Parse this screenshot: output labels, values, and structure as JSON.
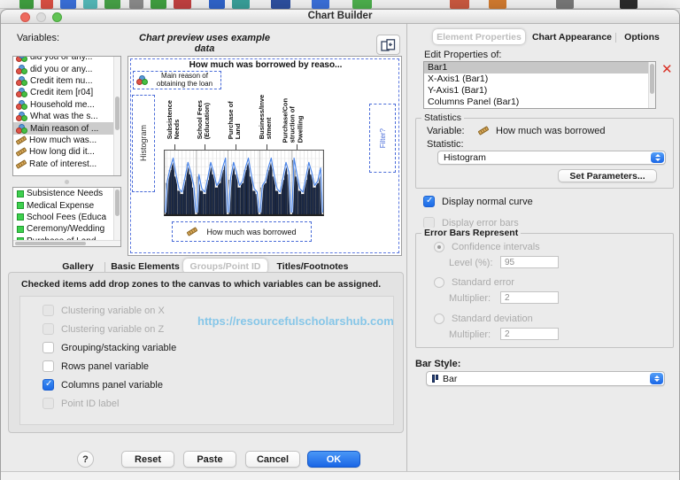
{
  "window": {
    "title": "Chart Builder"
  },
  "left": {
    "variables_label": "Variables:",
    "preview_caption": "Chart preview uses example data",
    "variables": [
      {
        "label": "did you or any..."
      },
      {
        "label": "did you or any..."
      },
      {
        "label": "Credit item nu..."
      },
      {
        "label": "Credit item [r04]"
      },
      {
        "label": "Household me..."
      },
      {
        "label": "What was the s..."
      },
      {
        "label": "Main reason of ..."
      },
      {
        "label": "How much was..."
      },
      {
        "label": "How long did it..."
      },
      {
        "label": "Rate of interest..."
      }
    ],
    "categories": [
      "Subsistence Needs",
      "Medical Expense",
      "School Fees (Educa",
      "Ceremony/Wedding",
      "Purchase of Land"
    ]
  },
  "preview": {
    "title": "How much was borrowed by reaso...",
    "row_drop_zone": "Main reason of obtaining the loan",
    "y_axis_zone": "Histogram",
    "x_axis_zone": "How much was borrowed",
    "filter_zone": "Filter?",
    "panel_labels": [
      "Subsistence\nNeeds",
      "School Fees\n(Education)",
      "Purchase of\nLand",
      "Business/Inve\nstment",
      "Purchase/Con\nstruction of\nDwelling"
    ]
  },
  "bottom_tabs": {
    "gallery": "Gallery",
    "basic_elements": "Basic Elements",
    "groups_point_id": "Groups/Point ID",
    "titles_footnotes": "Titles/Footnotes"
  },
  "groups_panel": {
    "description": "Checked items add drop zones to the canvas to which variables can be assigned.",
    "options": [
      {
        "label": "Clustering variable on X",
        "checked": false,
        "enabled": false
      },
      {
        "label": "Clustering variable on Z",
        "checked": false,
        "enabled": false
      },
      {
        "label": "Grouping/stacking variable",
        "checked": false,
        "enabled": true
      },
      {
        "label": "Rows panel variable",
        "checked": false,
        "enabled": true
      },
      {
        "label": "Columns panel variable",
        "checked": true,
        "enabled": true
      },
      {
        "label": "Point ID label",
        "checked": false,
        "enabled": false
      }
    ],
    "watermark": "https://resourcefulscholarshub.com"
  },
  "footer": {
    "help": "?",
    "reset": "Reset",
    "paste": "Paste",
    "cancel": "Cancel",
    "ok": "OK"
  },
  "right": {
    "tabs": {
      "element_properties": "Element Properties",
      "chart_appearance": "Chart Appearance",
      "options": "Options"
    },
    "edit_properties_label": "Edit Properties of:",
    "properties": [
      "Bar1",
      "X-Axis1 (Bar1)",
      "Y-Axis1 (Bar1)",
      "Columns Panel (Bar1)"
    ],
    "statistics": {
      "group_label": "Statistics",
      "variable_label": "Variable:",
      "variable_value": "How much was borrowed",
      "statistic_label": "Statistic:",
      "statistic_value": "Histogram",
      "set_parameters": "Set Parameters..."
    },
    "display_normal_curve": "Display normal curve",
    "display_error_bars": "Display error bars",
    "error_bars": {
      "group_label": "Error Bars Represent",
      "confidence_intervals": "Confidence intervals",
      "level_label": "Level (%):",
      "level_value": "95",
      "standard_error": "Standard error",
      "multiplier_label": "Multiplier:",
      "se_multiplier_value": "2",
      "standard_deviation": "Standard deviation",
      "sd_multiplier_value": "2"
    },
    "bar_style_label": "Bar Style:",
    "bar_style_value": "Bar"
  }
}
